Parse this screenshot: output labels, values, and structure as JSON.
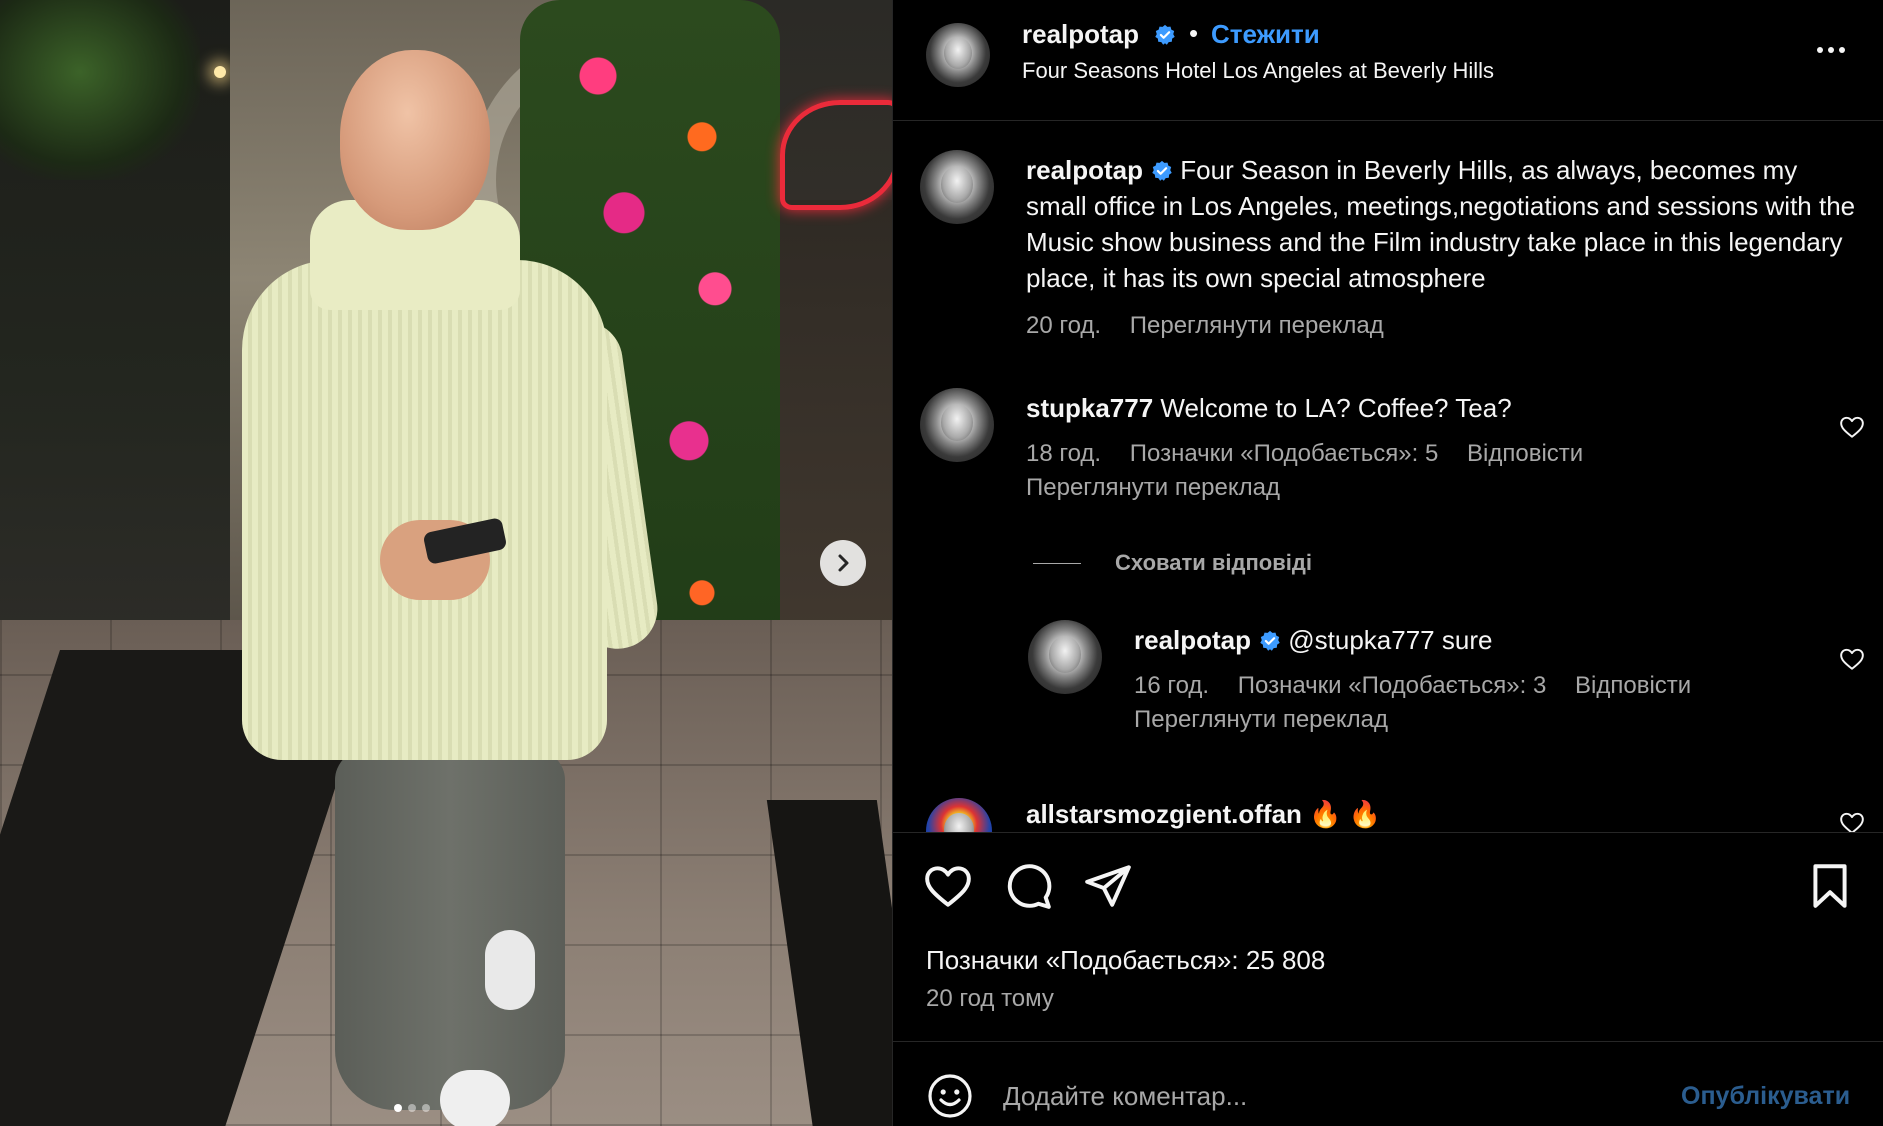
{
  "post": {
    "username": "realpotap",
    "follow_label": "Стежити",
    "separator": "•",
    "location": "Four Seasons Hotel Los Angeles at Beverly Hills",
    "caption": {
      "username": "realpotap",
      "text": "Four Season in Beverly Hills, as always, becomes my small office in Los Angeles, meetings,negotiations and sessions with the Music show business and the Film industry take place in this legendary place, it has its own special atmosphere",
      "time": "20 год.",
      "translate_label": "Переглянути переклад"
    },
    "photo": {
      "carousel_dots": 3,
      "active_dot": 0
    }
  },
  "comments": [
    {
      "username": "stupka777",
      "text": "Welcome to LA? Coffee? Tea?",
      "time": "18 год.",
      "likes": "Позначки «Подобається»: 5",
      "reply_label": "Відповісти",
      "translate_label": "Переглянути переклад"
    }
  ],
  "hide_replies_label": "Сховати відповіді",
  "reply": {
    "username": "realpotap",
    "text": "@stupka777 sure",
    "time": "16 год.",
    "likes": "Позначки «Подобається»: 3",
    "reply_label": "Відповісти",
    "translate_label": "Переглянути переклад"
  },
  "partial_comment": {
    "username": "allstarsmozgient.offan",
    "text": "🔥 🔥"
  },
  "actions": {
    "likes": "Позначки «Подобається»: 25 808",
    "time": "20 год тому"
  },
  "add_comment": {
    "placeholder": "Додайте коментар...",
    "post_label": "Опублікувати"
  },
  "colors": {
    "accent": "#3d9bff",
    "muted_text": "#a8a8a8",
    "post_disabled": "#2b5d8f",
    "verified": "#3d9bff"
  },
  "icons": [
    "more-icon",
    "verified-icon",
    "heart-icon",
    "comment-icon",
    "share-icon",
    "bookmark-icon",
    "emoji-icon",
    "chevron-right-icon"
  ]
}
